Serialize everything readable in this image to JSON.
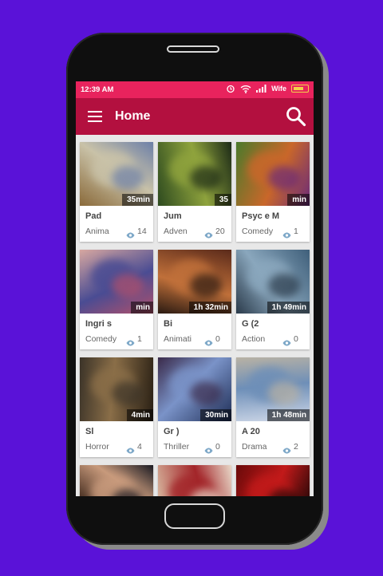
{
  "status_bar": {
    "time": "12:39 AM",
    "operator": "Wife",
    "colors": {
      "background": "#e8235d"
    }
  },
  "app_bar": {
    "title": "Home",
    "colors": {
      "background": "#b3103f"
    }
  },
  "movies": [
    {
      "title": "Pad",
      "duration": "35min",
      "genre": "Anima",
      "views": "14",
      "colors": [
        "#8a6a3a",
        "#c9c2a8",
        "#6c7fa8"
      ]
    },
    {
      "title": "Jum",
      "duration": "35",
      "genre": "Adven",
      "views": "20",
      "colors": [
        "#2d4a1f",
        "#8fa33d",
        "#1c2a17"
      ]
    },
    {
      "title": "Psyc e M",
      "duration": "min",
      "genre": "Comedy",
      "views": "1",
      "colors": [
        "#4b7a2b",
        "#c9672a",
        "#6a2a7a"
      ]
    },
    {
      "title": "Ingri s",
      "duration": "min",
      "genre": "Comedy",
      "views": "1",
      "colors": [
        "#d7a7a0",
        "#4a4c93",
        "#b3506a"
      ]
    },
    {
      "title": "Bi",
      "duration": "1h 32min",
      "genre": "Animati",
      "views": "0",
      "colors": [
        "#5a2a1a",
        "#c0703a",
        "#2a1a12"
      ]
    },
    {
      "title": "G (2",
      "duration": "1h 49min",
      "genre": "Action",
      "views": "0",
      "colors": [
        "#3f5f7a",
        "#8aa7bd",
        "#2a3a4a"
      ]
    },
    {
      "title": "Sl",
      "duration": "4min",
      "genre": "Horror",
      "views": "4",
      "colors": [
        "#2a2014",
        "#8a6e48",
        "#3b3328"
      ]
    },
    {
      "title": "Gr )",
      "duration": "30min",
      "genre": "Thriller",
      "views": "0",
      "colors": [
        "#1e2d55",
        "#7a93c8",
        "#3a2a4a"
      ]
    },
    {
      "title": "A 20",
      "duration": "1h 48min",
      "genre": "Drama",
      "views": "2",
      "colors": [
        "#cfd8e8",
        "#6e8fb8",
        "#b9b2a4"
      ]
    },
    {
      "title": "",
      "duration": "",
      "genre": "",
      "views": "",
      "colors": [
        "#3a2418",
        "#c89a7c",
        "#1a1a22"
      ]
    },
    {
      "title": "",
      "duration": "",
      "genre": "",
      "views": "",
      "colors": [
        "#d8b8a0",
        "#a3262a",
        "#e8d8c8"
      ]
    },
    {
      "title": "",
      "duration": "",
      "genre": "",
      "views": "",
      "colors": [
        "#6a0a0a",
        "#c21a1a",
        "#2a0808"
      ]
    }
  ],
  "icons": {
    "menu": "menu-icon",
    "search": "search-icon",
    "views": "eye-icon"
  }
}
